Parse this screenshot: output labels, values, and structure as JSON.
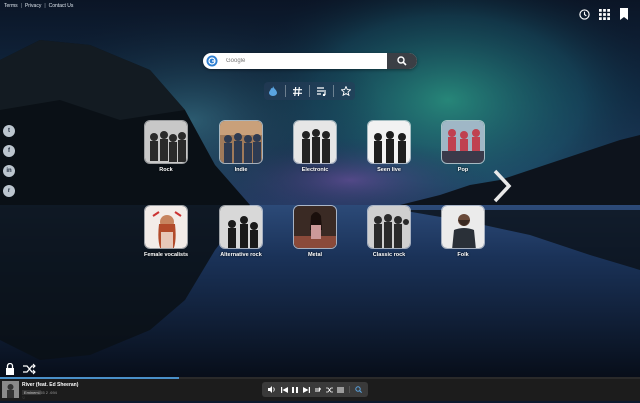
{
  "header": {
    "links": [
      "Terms",
      "Privacy",
      "Contact Us"
    ],
    "separator": "|",
    "icons": [
      "history-icon",
      "apps-grid-icon",
      "bookmark-icon"
    ]
  },
  "search": {
    "placeholder": "Google",
    "engine_icon": "google-search-icon",
    "button_icon": "magnifier-icon"
  },
  "category_tabs": [
    {
      "name": "tab-trending",
      "icon": "flame-icon"
    },
    {
      "name": "tab-genres",
      "icon": "hashtag-icon"
    },
    {
      "name": "tab-playlists",
      "icon": "playlist-icon"
    },
    {
      "name": "tab-favorites",
      "icon": "star-icon"
    }
  ],
  "social": [
    {
      "name": "twitter-icon",
      "glyph": "t"
    },
    {
      "name": "facebook-icon",
      "glyph": "f"
    },
    {
      "name": "linkedin-icon",
      "glyph": "in"
    },
    {
      "name": "reddit-icon",
      "glyph": "r"
    }
  ],
  "genres": [
    {
      "label": "Rock",
      "tint": "#7a7a7a"
    },
    {
      "label": "Indie",
      "tint": "#6e7d8f"
    },
    {
      "label": "Electronic",
      "tint": "#8a8a8a"
    },
    {
      "label": "Seen live",
      "tint": "#bfbfbf"
    },
    {
      "label": "Pop",
      "tint": "#c0414f"
    },
    {
      "label": "Female vocalists",
      "tint": "#e8c9c0"
    },
    {
      "label": "Alternative rock",
      "tint": "#5a5a5a"
    },
    {
      "label": "Metal",
      "tint": "#8a4a3a"
    },
    {
      "label": "Classic rock",
      "tint": "#a8a8a8"
    },
    {
      "label": "Folk",
      "tint": "#d8d8d8"
    }
  ],
  "player": {
    "title": "River (feat. Ed Sheeran)",
    "artist": "Eminem",
    "views": "155 2 .694",
    "extra": "♡",
    "progress": 0.28
  },
  "colors": {
    "accent": "#2f7fd1",
    "player_bg": "#1c1c1c"
  }
}
